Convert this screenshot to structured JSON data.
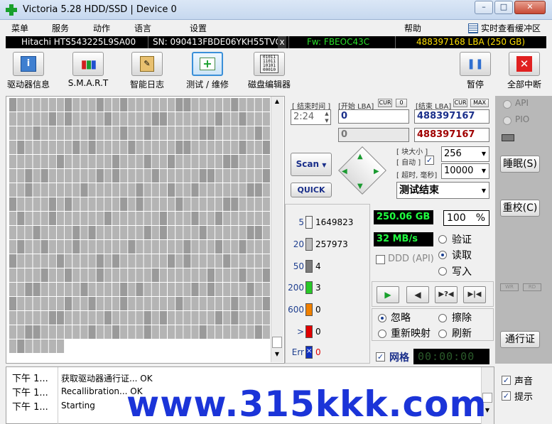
{
  "window": {
    "title": "Victoria 5.28 HDD/SSD | Device 0"
  },
  "menu": {
    "items": [
      "菜单",
      "服务",
      "动作",
      "语言",
      "设置",
      "帮助"
    ],
    "realtime_label": "实时查看缓冲区"
  },
  "device": {
    "model": "Hitachi HTS543225L9SA00",
    "serial": "SN: 090413FBDE06YKH55TVC",
    "close": "x",
    "firmware": "Fw: FBEOC43C",
    "capacity": "488397168 LBA (250 GB)"
  },
  "toolbar": {
    "driver_info": "驱动器信息",
    "smart": "S.M.A.R.T",
    "smart_log": "智能日志",
    "test": "测试 / 维修",
    "editor": "磁盘编辑器",
    "pause": "暂停",
    "abort": "全部中断"
  },
  "controls": {
    "end_time_label": "[ 结束时间 ]",
    "end_time_value": "2:24",
    "start_lba_label": "[开始 LBA]",
    "cur_label": "CUR",
    "cur_value": "0",
    "end_lba_label": "[结束 LBA]",
    "max_label": "MAX",
    "start_lba": "0",
    "start_lba_current": "0",
    "end_lba": "488397167",
    "end_lba_current": "488397167",
    "block_size_label": "[ 块大小 ]",
    "auto_label": "[ 自动 ]",
    "timeout_label": "[ 超时, 毫秒]",
    "block_size": "256",
    "timeout": "10000",
    "scan_button": "Scan",
    "quick_button": "QUICK",
    "status_select": "测试结束",
    "api_label": "API",
    "pio_label": "PIO"
  },
  "stats": [
    {
      "label": "5",
      "count": "1649823",
      "color": "#f4f4f4"
    },
    {
      "label": "20",
      "count": "257973",
      "color": "#bcbcbc"
    },
    {
      "label": "50",
      "count": "4",
      "color": "#7a7a7a"
    },
    {
      "label": "200",
      "count": "3",
      "color": "#28c828"
    },
    {
      "label": "600",
      "count": "0",
      "color": "#f08000"
    },
    {
      "label": ">",
      "count": "0",
      "color": "#e00000"
    },
    {
      "label": "Err",
      "count": "0",
      "color": "#1030c0"
    }
  ],
  "status": {
    "processed": "250.06 GB",
    "percent": "100",
    "percent_unit": "%",
    "speed": "32 MB/s",
    "ddd_label": "DDD (API)",
    "verify": "验证",
    "read": "读取",
    "write": "写入",
    "ignore": "忽略",
    "erase": "擦除",
    "remap": "重新映射",
    "refresh": "刷新",
    "grid_label": "网格",
    "timer": "00:00:00"
  },
  "side": {
    "sleep": "睡眠(S)",
    "recal": "重校(C)",
    "passport": "通行证",
    "wr": "WR",
    "rd": "RD"
  },
  "log": [
    {
      "time": "下午 1...",
      "msg": "获取驱动器通行证... OK"
    },
    {
      "time": "下午 1...",
      "msg": "Recallibration... OK"
    },
    {
      "time": "下午 1...",
      "msg": "Starting"
    }
  ],
  "bottom": {
    "sound": "声音",
    "hints": "提示"
  },
  "watermark": "www.315kkk.com",
  "colors": {
    "map_cell": "#b4b4b4",
    "map_cell_dark": "#9a9a9a",
    "lcd_green": "#20ff40",
    "lcd_yellow": "#ffe000",
    "lba_red": "#a00000"
  }
}
